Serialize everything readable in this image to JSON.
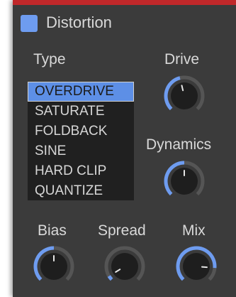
{
  "header": {
    "title": "Distortion",
    "enabled": true
  },
  "type_section": {
    "label": "Type",
    "options": [
      "OVERDRIVE",
      "SATURATE",
      "FOLDBACK",
      "SINE",
      "HARD CLIP",
      "QUANTIZE"
    ],
    "selected": "OVERDRIVE"
  },
  "knobs": {
    "drive": {
      "label": "Drive",
      "value": 0.45
    },
    "dynamics": {
      "label": "Dynamics",
      "value": 0.5
    },
    "bias": {
      "label": "Bias",
      "value": 0.5
    },
    "spread": {
      "label": "Spread",
      "value": 0.05
    },
    "mix": {
      "label": "Mix",
      "value": 0.85
    }
  },
  "colors": {
    "accent": "#6e9cf0",
    "panel": "#3b3b3b",
    "list_bg": "#202020",
    "top_bar": "#c0282a",
    "knob_track": "#555555",
    "knob_body": "#1e1e1e"
  }
}
